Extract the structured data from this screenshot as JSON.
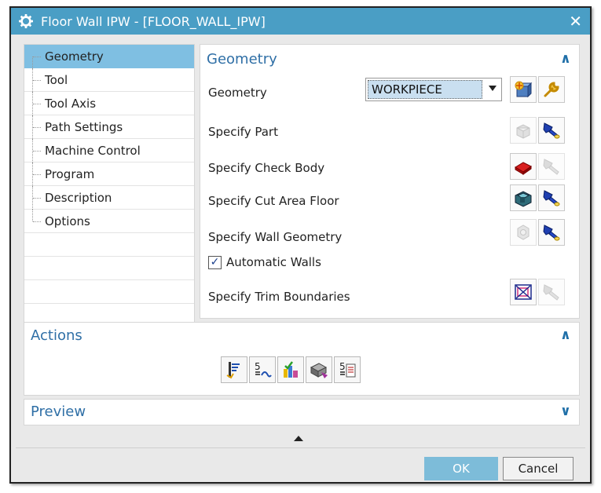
{
  "window": {
    "title": "Floor Wall IPW - [FLOOR_WALL_IPW]",
    "close_label": "✕"
  },
  "nav": {
    "items": [
      {
        "label": "Geometry",
        "selected": true
      },
      {
        "label": "Tool"
      },
      {
        "label": "Tool Axis"
      },
      {
        "label": "Path Settings"
      },
      {
        "label": "Machine Control"
      },
      {
        "label": "Program"
      },
      {
        "label": "Description"
      },
      {
        "label": "Options"
      }
    ]
  },
  "geometry": {
    "header": "Geometry",
    "geometry_label": "Geometry",
    "geometry_value": "WORKPIECE",
    "specify_part": "Specify Part",
    "specify_check_body": "Specify Check Body",
    "specify_cut_area_floor": "Specify Cut Area Floor",
    "specify_wall_geometry": "Specify Wall Geometry",
    "automatic_walls": "Automatic Walls",
    "automatic_walls_checked": true,
    "specify_trim_boundaries": "Specify Trim Boundaries"
  },
  "actions": {
    "header": "Actions"
  },
  "preview": {
    "header": "Preview"
  },
  "buttons": {
    "ok": "OK",
    "cancel": "Cancel"
  },
  "colors": {
    "titlebar": "#4a9ec5",
    "selection": "#7fbfe2",
    "section_title": "#2f6fa6",
    "ok_button": "#7dbcd9"
  }
}
